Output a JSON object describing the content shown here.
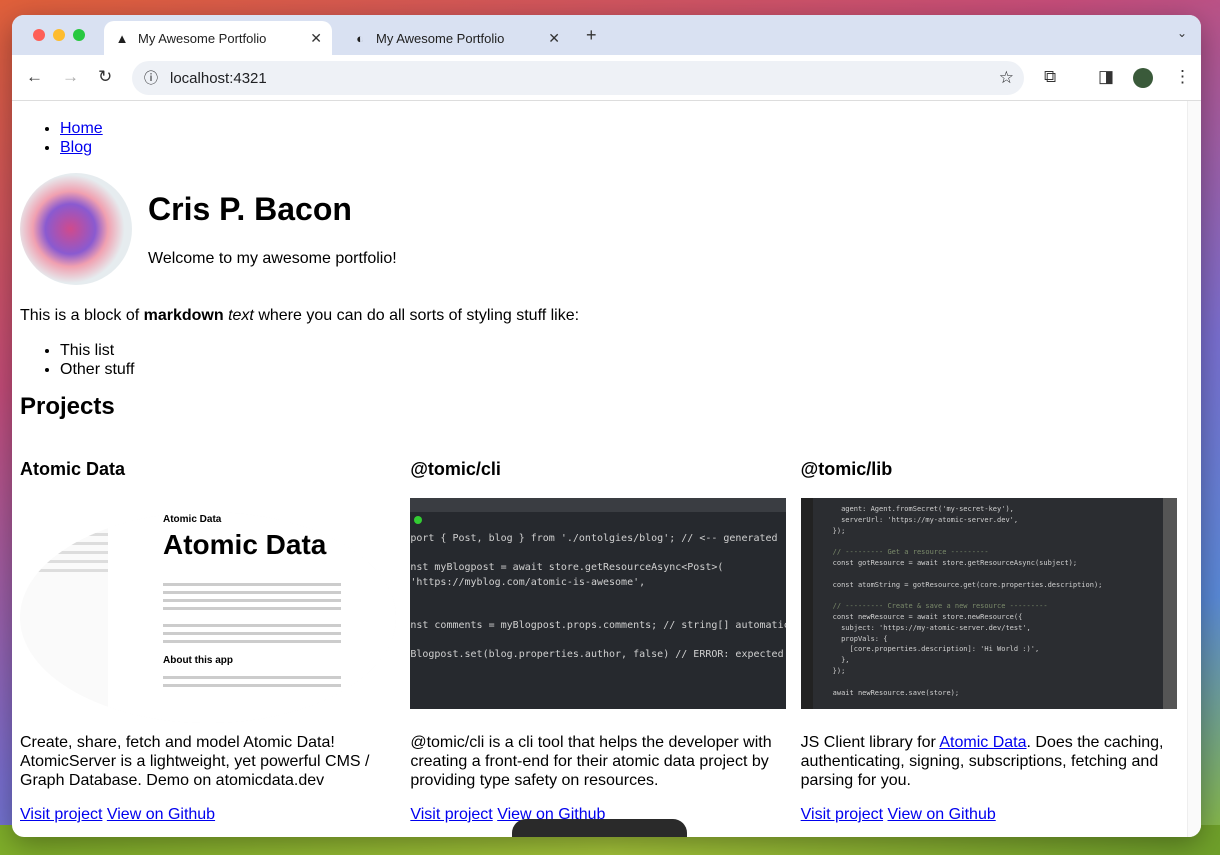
{
  "browser": {
    "tabs": [
      {
        "title": "My Awesome Portfolio",
        "icon": "astro-icon"
      },
      {
        "title": "My Awesome Portfolio",
        "icon": "atomic-icon"
      }
    ],
    "url": "localhost:4321"
  },
  "nav": [
    "Home",
    "Blog"
  ],
  "hero": {
    "name": "Cris P. Bacon",
    "tagline": "Welcome to my awesome portfolio!"
  },
  "markdown": {
    "pre": "This is a block of ",
    "bold": "markdown",
    "italic": "text",
    "post": " where you can do all sorts of styling stuff like:",
    "items": [
      "This list",
      "Other stuff"
    ]
  },
  "projects_title": "Projects",
  "projects": [
    {
      "title": "Atomic Data",
      "desc_pre": "Create, share, fetch and model Atomic Data! AtomicServer is a lightweight, yet powerful CMS / Graph Database. Demo on atomicdata.dev",
      "desc_link": "",
      "desc_post": "",
      "shot": {
        "label": "Atomic Data",
        "heading": "Atomic Data",
        "sub": "About this app"
      }
    },
    {
      "title": "@tomic/cli",
      "desc_pre": "@tomic/cli is a cli tool that helps the developer with creating a front-end for their atomic data project by providing type safety on resources.",
      "desc_link": "",
      "desc_post": "",
      "code": [
        "port { Post, blog } from './ontolgies/blog'; // <-- generated",
        "",
        "nst myBlogpost = await store.getResourceAsync<Post>(",
        "'https://myblog.com/atomic-is-awesome',",
        "",
        "",
        "nst comments = myBlogpost.props.comments; // string[] automatically inferred",
        "",
        "Blogpost.set(blog.properties.author, false) // ERROR: expected string got boo"
      ]
    },
    {
      "title": "@tomic/lib",
      "desc_pre": "JS Client library for ",
      "desc_link": "Atomic Data",
      "desc_post": ". Does the caching, authenticating, signing, subscriptions, fetching and parsing for you.",
      "code": [
        "  agent: Agent.fromSecret('my-secret-key'),",
        "  serverUrl: 'https://my-atomic-server.dev',",
        "});",
        "",
        "// --------- Get a resource ---------",
        "const gotResource = await store.getResourceAsync(subject);",
        "",
        "const atomString = gotResource.get(core.properties.description);",
        "",
        "// --------- Create & save a new resource ---------",
        "const newResource = await store.newResource({",
        "  subject: 'https://my-atomic-server.dev/test',",
        "  propVals: {",
        "    [core.properties.description]: 'Hi World :)',",
        "  },",
        "});",
        "",
        "await newResource.save(store);"
      ]
    }
  ],
  "links": {
    "visit": "Visit project",
    "github": "View on Github"
  }
}
